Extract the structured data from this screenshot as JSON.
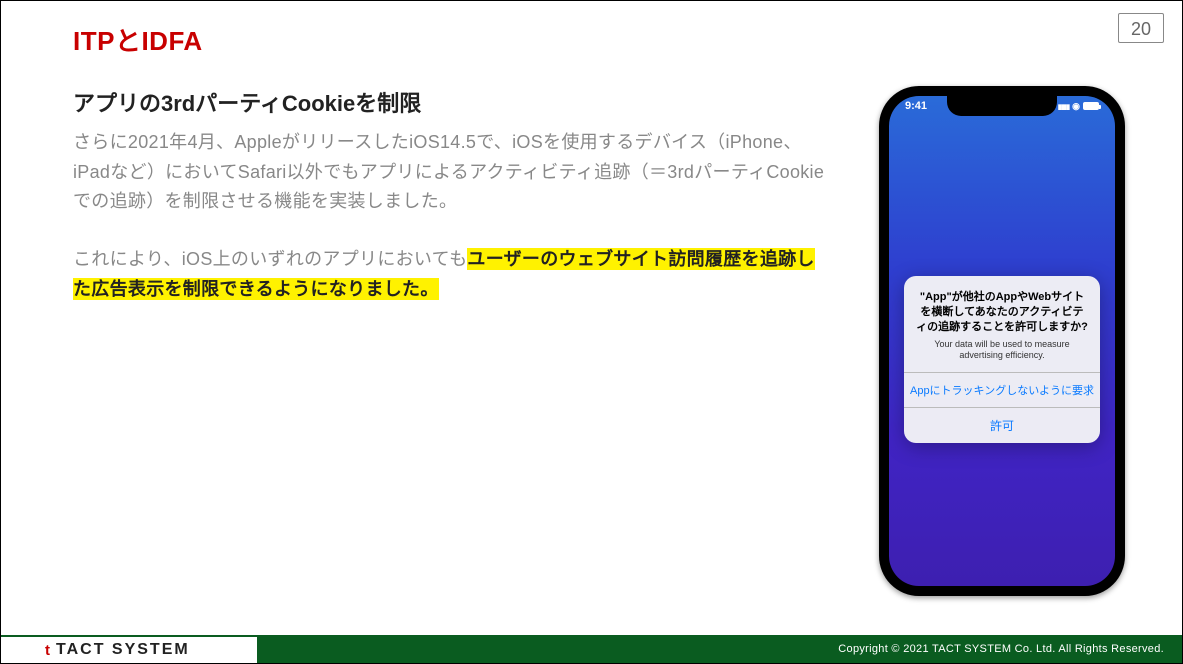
{
  "title": "ITPとIDFA",
  "pageNumber": "20",
  "subtitle": "アプリの3rdパーティCookieを制限",
  "para1": "さらに2021年4月、AppleがリリースしたiOS14.5で、iOSを使用するデバイス（iPhone、iPadなど）においてSafari以外でもアプリによるアクティビティ追跡（＝3rdパーティCookieでの追跡）を制限させる機能を実装しました。",
  "para2_lead": "これにより、iOS上のいずれのアプリにおいても",
  "para2_hl": "ユーザーのウェブサイト訪問履歴を追跡した広告表示を制限できるようになりました。",
  "phone": {
    "time": "9:41",
    "dialog": {
      "titleLines": "\"App\"が他社のAppやWebサイトを横断してあなたのアクティビティの追跡することを許可しますか?",
      "subtitle": "Your data will be used to measure advertising efficiency.",
      "deny": "Appにトラッキングしないように要求",
      "allow": "許可"
    }
  },
  "footer": {
    "logoText": "TACT SYSTEM",
    "copyright": "Copyright © 2021 TACT SYSTEM Co. Ltd. All Rights Reserved."
  }
}
